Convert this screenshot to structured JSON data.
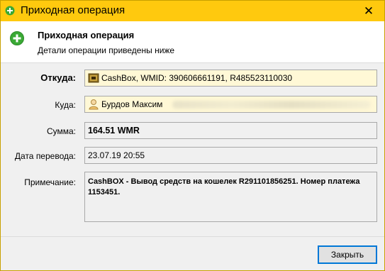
{
  "window": {
    "title": "Приходная операция",
    "close_glyph": "✕"
  },
  "header": {
    "title": "Приходная операция",
    "subtitle": "Детали операции приведены ниже"
  },
  "fields": {
    "from_label": "Откуда:",
    "from_value": "CashBox, WMID: 390606661191, R485523110030",
    "to_label": "Куда:",
    "to_value": "Бурдов Максим",
    "amount_label": "Сумма:",
    "amount_value": "164.51 WMR",
    "date_label": "Дата перевода:",
    "date_value": "23.07.19 20:55",
    "note_label": "Примечание:",
    "note_value": "CashBOX - Вывод средств на кошелек R291101856251. Номер платежа 1153451."
  },
  "footer": {
    "close_button": "Закрыть"
  },
  "colors": {
    "titlebar": "#ffc90e",
    "field_highlight": "#fff8d6",
    "accent": "#0078d7"
  }
}
